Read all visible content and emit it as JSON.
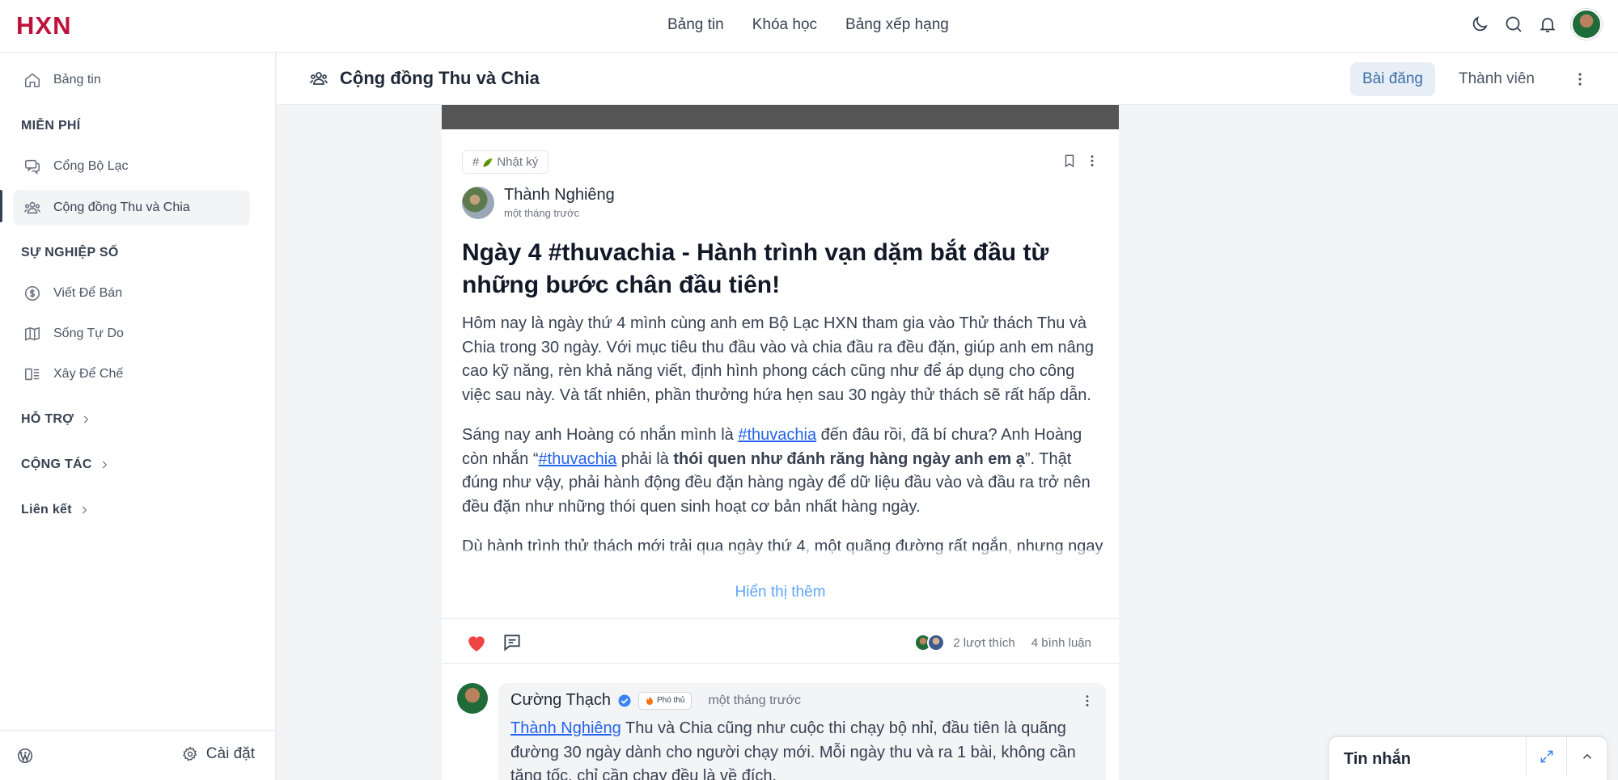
{
  "brand": {
    "logo": "HXN",
    "accent": "#be123c"
  },
  "topnav": [
    "Bảng tin",
    "Khóa học",
    "Bảng xếp hạng"
  ],
  "top_icons": [
    "moon-icon",
    "search-icon",
    "bell-icon",
    "avatar"
  ],
  "sidebar": {
    "home": "Bảng tin",
    "sections": [
      {
        "title": "MIỄN PHÍ",
        "items": [
          "Cổng Bộ Lạc",
          "Cộng đồng Thu và Chia"
        ]
      },
      {
        "title": "SỰ NGHIỆP SỐ",
        "items": [
          "Viết Để Bán",
          "Sống Tự Do",
          "Xây Để Chế"
        ]
      }
    ],
    "collapsed": [
      "HỖ TRỢ",
      "CỘNG TÁC",
      "Liên kết"
    ],
    "active_item": "Cộng đồng Thu và Chia",
    "settings_label": "Cài đặt"
  },
  "subheader": {
    "title": "Cộng đồng Thu và Chia",
    "tabs": [
      "Bài đăng",
      "Thành viên"
    ],
    "active_tab": "Bài đăng"
  },
  "post": {
    "tag": "Nhật ký",
    "author": "Thành Nghiêng",
    "time": "một tháng trước",
    "title": "Ngày 4 #thuvachia - Hành trình vạn dặm bắt đầu từ những bước chân đầu tiên!",
    "paragraph1": "Hôm nay là ngày thứ 4 mình cùng anh em Bộ Lạc HXN tham gia vào Thử thách Thu và Chia trong 30 ngày. Với mục tiêu thu đầu vào và chia đầu ra đều đặn, giúp anh em nâng cao kỹ năng, rèn khả năng viết, định hình phong cách cũng như để áp dụng cho công việc sau này. Và tất nhiên, phần thưởng hứa hẹn sau 30 ngày thử thách sẽ rất hấp dẫn.",
    "p2_a": "Sáng nay anh Hoàng có nhắn mình là ",
    "p2_hashtag1": "#thuvachia",
    "p2_b": " đến đâu rồi, đã bí chưa? Anh Hoàng còn nhắn “",
    "p2_hashtag2": "#thuvachia",
    "p2_c": " phải là ",
    "p2_bold": "thói quen như đánh răng hàng ngày anh em ạ",
    "p2_d": "”. Thật đúng như vậy, phải hành động đều đặn hàng ngày để dữ liệu đầu vào và đầu ra trở nên đều đặn như những thói quen sinh hoạt cơ bản nhất hàng ngày.",
    "paragraph3": "Dù hành trình thử thách mới trải qua ngày thứ 4, một quãng đường rất ngắn, nhưng ngay từ những ngày đầu tiên này, anh em đã thấy nếu đủ kiên trì và quyết tâm thì sao có",
    "show_more": "Hiển thị thêm",
    "likes": "2 lượt thích",
    "comments": "4 bình luận"
  },
  "comment": {
    "author": "Cường Thạch",
    "badge": "Phó thủ",
    "time": "một tháng trước",
    "mention": "Thành Nghiêng",
    "text": " Thu và Chia cũng như cuộc thi chạy bộ nhỉ, đầu tiên là quãng đường 30 ngày dành cho người chạy mới. Mỗi ngày thu và ra 1 bài, không cần tăng tốc, chỉ cần chạy đều là về đích."
  },
  "chat": {
    "title": "Tin nhắn"
  }
}
